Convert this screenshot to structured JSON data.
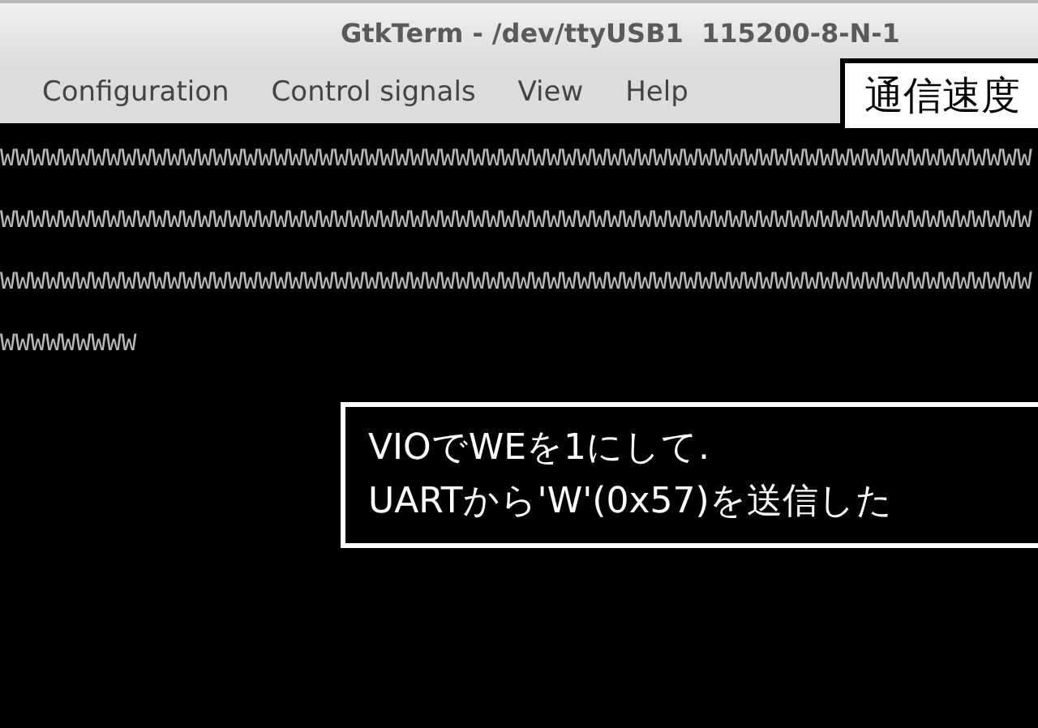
{
  "window": {
    "title": "GtkTerm - /dev/ttyUSB1  115200-8-N-1"
  },
  "menu": [
    "Configuration",
    "Control signals",
    "View",
    "Help"
  ],
  "terminal": {
    "lines": [
      "WWWWWWWWWWWWWWWWWWWWWWWWWWWWWWWWWWWWWWWWWWWWWWWWWWWWWWWWWWWWWWWWWWWW",
      "WWWWWWWWWWWWWWWWWWWWWWWWWWWWWWWWWWWWWWWWWWWWWWWWWWWWWWWWWWWWWWWWWWWW",
      "WWWWWWWWWWWWWWWWWWWWWWWWWWWWWWWWWWWWWWWWWWWWWWWWWWWWWWWWWWWWWWWWWWWW",
      "WWWWWWWWW"
    ]
  },
  "annotations": [
    {
      "kind": "light",
      "lines": [
        "通信速度"
      ]
    },
    {
      "kind": "dark",
      "lines": [
        "VIOでWEを1にして.",
        "UARTから'W'(0x57)を送信した"
      ]
    }
  ]
}
